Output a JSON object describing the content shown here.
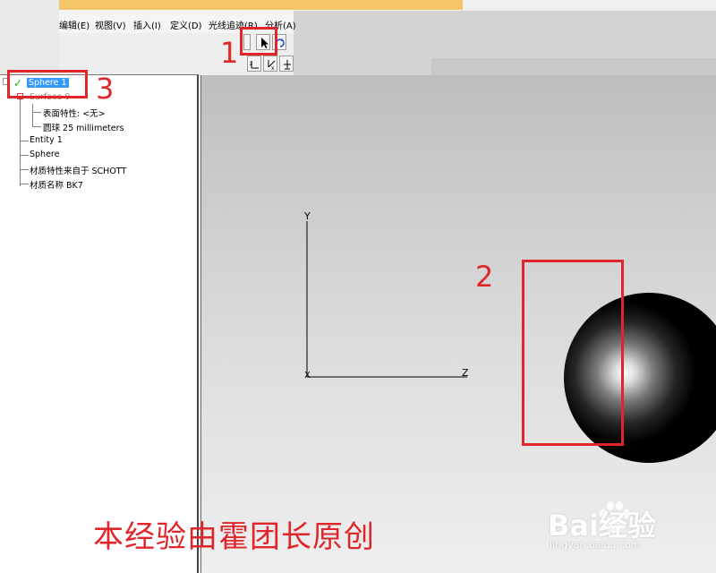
{
  "menu": {
    "items": [
      "编辑(E)",
      "视图(V)",
      "插入(I)",
      "定义(D)",
      "光线追迹(R)",
      "分析(A)"
    ]
  },
  "tree": {
    "root_label": "Sphere 1",
    "surface_label": "Surface 0",
    "surface_prop": "表面特性: <无>",
    "surface_shape": "圆球 25 millimeters",
    "entity_label": "Entity 1",
    "sphere_label": "Sphere",
    "material_source": "材质特性来自于 SCHOTT",
    "material_name": "材质名称 BK7"
  },
  "viewport": {
    "y_axis_label": "Y",
    "z_axis_label": "Z",
    "x_axis_label": "X"
  },
  "annotations": {
    "n1": "1",
    "n2": "2",
    "n3": "3"
  },
  "watermark": {
    "author_text": "本经验由霍团长原创",
    "brand": "Bai经验",
    "url": "jingyan.baidu.com"
  },
  "colors": {
    "annotation_red": "#e0262b",
    "selection_blue": "#3399ff",
    "top_strip": "#f5c56a"
  },
  "icons": {
    "select_tool": "arrow-pointer-icon",
    "axis_view_1": "axis-zx-icon",
    "axis_view_2": "axis-yx-icon",
    "axis_view_3": "axis-zy-icon",
    "tree_check": "check-icon"
  }
}
